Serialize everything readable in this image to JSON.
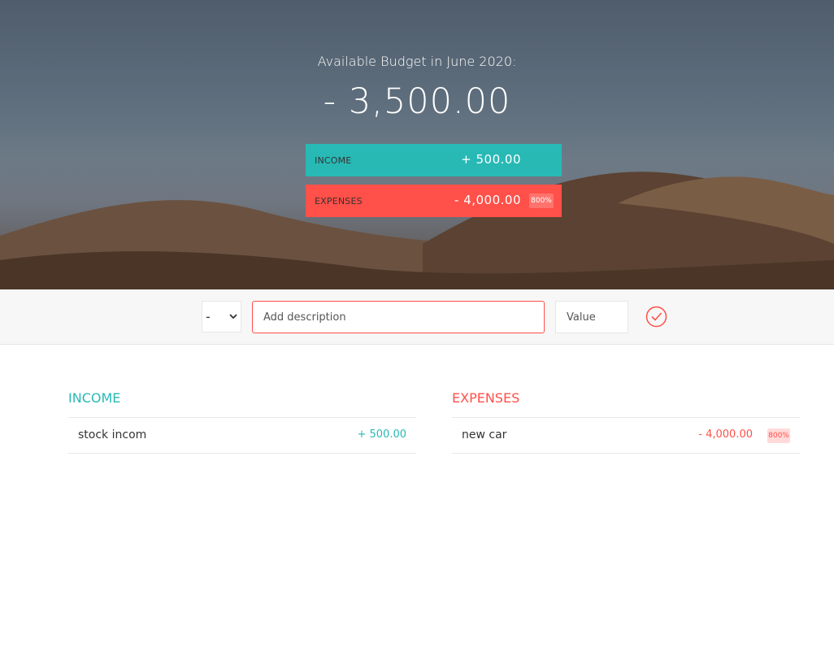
{
  "budget": {
    "title": "Available Budget in June 2020:",
    "value": "- 3,500.00"
  },
  "summary": {
    "income": {
      "label": "INCOME",
      "amount": "+ 500.00"
    },
    "expenses": {
      "label": "EXPENSES",
      "amount": "- 4,000.00",
      "percentage": "800%"
    }
  },
  "add_form": {
    "type_selected": "-",
    "description_placeholder": "Add description",
    "value_placeholder": "Value"
  },
  "lists": {
    "income": {
      "title": "INCOME",
      "items": [
        {
          "description": "stock incom",
          "value": "+ 500.00"
        }
      ]
    },
    "expenses": {
      "title": "EXPENSES",
      "items": [
        {
          "description": "new car",
          "value": "- 4,000.00",
          "percentage": "800%"
        }
      ]
    }
  },
  "colors": {
    "income": "#28b9b5",
    "expenses": "#ff5049"
  },
  "icons": {
    "submit": "check-circle-icon",
    "select_caret": "chevron-down-icon"
  }
}
